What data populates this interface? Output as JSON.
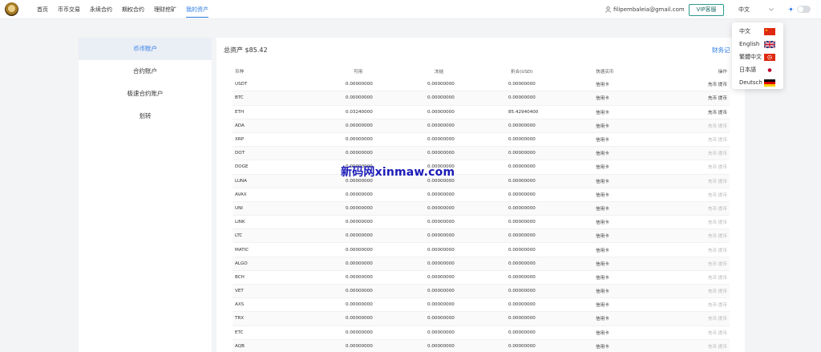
{
  "nav": {
    "logo_icon": "gold-coin-logo-icon",
    "menu": [
      {
        "label": "首页",
        "active": false
      },
      {
        "label": "币币交易",
        "active": false
      },
      {
        "label": "永续合约",
        "active": false
      },
      {
        "label": "期权合约",
        "active": false
      },
      {
        "label": "理财挖矿",
        "active": false
      },
      {
        "label": "我的资产",
        "active": true
      }
    ],
    "user_email": "filipembaleia@gmail.com",
    "vip_label": "VIP客服",
    "language_selected": "中文",
    "accent_color": "#2d7be5"
  },
  "language_menu": [
    {
      "label": "中文",
      "flag": "china-flag-icon"
    },
    {
      "label": "English",
      "flag": "uk-flag-icon"
    },
    {
      "label": "繁體中文",
      "flag": "hongkong-flag-icon"
    },
    {
      "label": "日本語",
      "flag": "japan-flag-icon"
    },
    {
      "label": "Deutsch",
      "flag": "germany-flag-icon"
    }
  ],
  "sidebar": {
    "items": [
      {
        "label": "币币账户",
        "active": true
      },
      {
        "label": "合约账户",
        "active": false
      },
      {
        "label": "极速合约账户",
        "active": false
      },
      {
        "label": "划转",
        "active": false
      }
    ]
  },
  "main": {
    "total_assets": "总资产 $85.42",
    "finance_link": "财务记",
    "table": {
      "headers": {
        "coin": "币种",
        "available": "可用",
        "frozen": "冻结",
        "usd": "折合(USD)",
        "quick_buy": "快速买币",
        "operation": "操作"
      },
      "rows": [
        {
          "coin": "USDT",
          "available": "0.00000000",
          "frozen": "0.00000000",
          "usd": "0.00000000",
          "quick_buy": "信用卡",
          "op": "充币 提币",
          "enabled": true
        },
        {
          "coin": "BTC",
          "available": "0.00000000",
          "frozen": "0.00000000",
          "usd": "0.00000000",
          "quick_buy": "信用卡",
          "op": "充币 提币",
          "enabled": true
        },
        {
          "coin": "ETH",
          "available": "0.03240000",
          "frozen": "0.00000000",
          "usd": "85.42940400",
          "quick_buy": "信用卡",
          "op": "充币 提币",
          "enabled": true
        },
        {
          "coin": "ADA",
          "available": "0.00000000",
          "frozen": "0.00000000",
          "usd": "0.00000000",
          "quick_buy": "信用卡",
          "op": "充币 提币",
          "enabled": false
        },
        {
          "coin": "XRP",
          "available": "0.00000000",
          "frozen": "0.00000000",
          "usd": "0.00000000",
          "quick_buy": "信用卡",
          "op": "充币 提币",
          "enabled": false
        },
        {
          "coin": "DOT",
          "available": "0.00000000",
          "frozen": "0.00000000",
          "usd": "0.00000000",
          "quick_buy": "信用卡",
          "op": "充币 提币",
          "enabled": false
        },
        {
          "coin": "DOGE",
          "available": "0.00000000",
          "frozen": "0.00000000",
          "usd": "0.00000000",
          "quick_buy": "信用卡",
          "op": "充币 提币",
          "enabled": false
        },
        {
          "coin": "LUNA",
          "available": "0.00000000",
          "frozen": "0.00000000",
          "usd": "0.00000000",
          "quick_buy": "信用卡",
          "op": "充币 提币",
          "enabled": false
        },
        {
          "coin": "AVAX",
          "available": "0.00000000",
          "frozen": "0.00000000",
          "usd": "0.00000000",
          "quick_buy": "信用卡",
          "op": "充币 提币",
          "enabled": false
        },
        {
          "coin": "UNI",
          "available": "0.00000000",
          "frozen": "0.00000000",
          "usd": "0.00000000",
          "quick_buy": "信用卡",
          "op": "充币 提币",
          "enabled": false
        },
        {
          "coin": "LINK",
          "available": "0.00000000",
          "frozen": "0.00000000",
          "usd": "0.00000000",
          "quick_buy": "信用卡",
          "op": "充币 提币",
          "enabled": false
        },
        {
          "coin": "LTC",
          "available": "0.00000000",
          "frozen": "0.00000000",
          "usd": "0.00000000",
          "quick_buy": "信用卡",
          "op": "充币 提币",
          "enabled": false
        },
        {
          "coin": "MATIC",
          "available": "0.00000000",
          "frozen": "0.00000000",
          "usd": "0.00000000",
          "quick_buy": "信用卡",
          "op": "充币 提币",
          "enabled": false
        },
        {
          "coin": "ALGO",
          "available": "0.00000000",
          "frozen": "0.00000000",
          "usd": "0.00000000",
          "quick_buy": "信用卡",
          "op": "充币 提币",
          "enabled": false
        },
        {
          "coin": "BCH",
          "available": "0.00000000",
          "frozen": "0.00000000",
          "usd": "0.00000000",
          "quick_buy": "信用卡",
          "op": "充币 提币",
          "enabled": false
        },
        {
          "coin": "VET",
          "available": "0.00000000",
          "frozen": "0.00000000",
          "usd": "0.00000000",
          "quick_buy": "信用卡",
          "op": "充币 提币",
          "enabled": false
        },
        {
          "coin": "AXS",
          "available": "0.00000000",
          "frozen": "0.00000000",
          "usd": "0.00000000",
          "quick_buy": "信用卡",
          "op": "充币 提币",
          "enabled": false
        },
        {
          "coin": "TRX",
          "available": "0.00000000",
          "frozen": "0.00000000",
          "usd": "0.00000000",
          "quick_buy": "信用卡",
          "op": "充币 提币",
          "enabled": false
        },
        {
          "coin": "ETC",
          "available": "0.00000000",
          "frozen": "0.00000000",
          "usd": "0.00000000",
          "quick_buy": "信用卡",
          "op": "充币 提币",
          "enabled": false
        },
        {
          "coin": "AQB",
          "available": "0.00000000",
          "frozen": "0.00000000",
          "usd": "0.00000000",
          "quick_buy": "信用卡",
          "op": "充币 提币",
          "enabled": false
        }
      ]
    }
  },
  "watermark": "新码网xinmaw.com"
}
